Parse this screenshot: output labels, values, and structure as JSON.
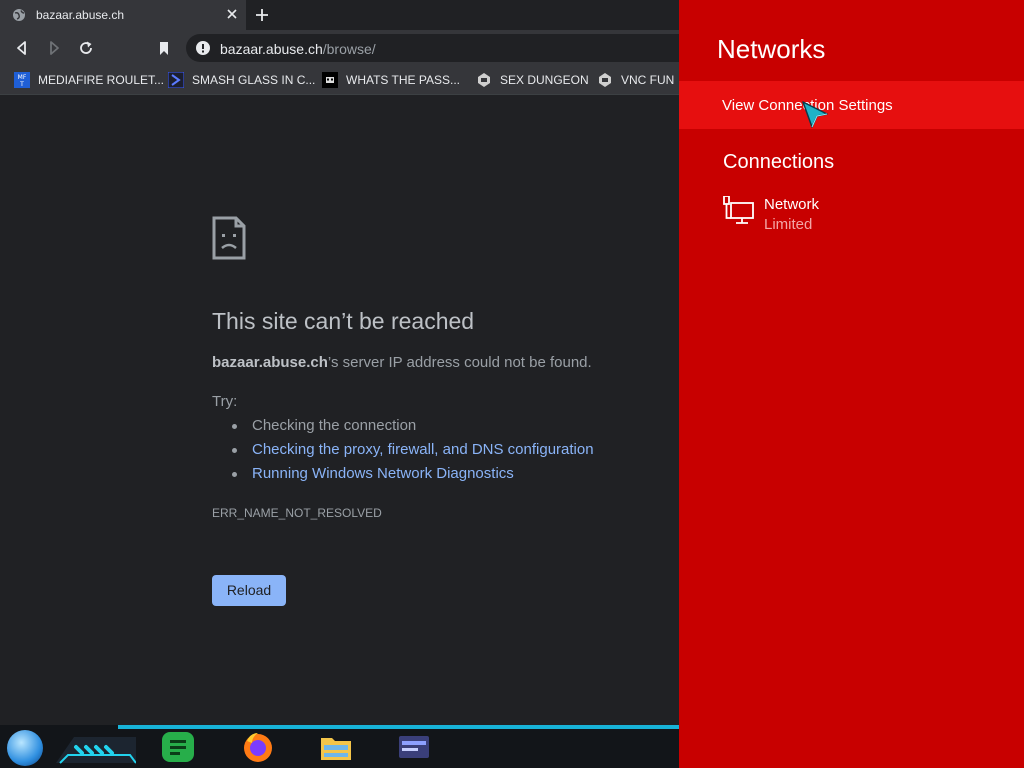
{
  "browser": {
    "tab": {
      "title": "bazaar.abuse.ch",
      "close_glyph": "×"
    },
    "new_tab_glyph": "+",
    "omnibox": {
      "host": "bazaar.abuse.ch",
      "path": "/browse/"
    },
    "bookmarks": [
      {
        "label": "MEDIAFIRE ROULET..."
      },
      {
        "label": "SMASH GLASS IN C..."
      },
      {
        "label": "WHATS THE PASS..."
      },
      {
        "label": "SEX DUNGEON"
      },
      {
        "label": "VNC FUN"
      }
    ]
  },
  "error_page": {
    "title": "This site can’t be reached",
    "host": "bazaar.abuse.ch",
    "message_suffix": "’s server IP address could not be found.",
    "try_label": "Try:",
    "suggestions": [
      {
        "text": "Checking the connection",
        "link": false
      },
      {
        "text": "Checking the proxy, firewall, and DNS configuration",
        "link": true
      },
      {
        "text": "Running Windows Network Diagnostics",
        "link": true
      }
    ],
    "error_code": "ERR_NAME_NOT_RESOLVED",
    "reload_label": "Reload"
  },
  "networks_panel": {
    "title": "Networks",
    "view_settings_label": "View Connection Settings",
    "connections_heading": "Connections",
    "network": {
      "name": "Network",
      "status": "Limited"
    }
  },
  "colors": {
    "panel_bg": "#c80000",
    "panel_highlight": "#e60f0f",
    "link": "#8ab4f8",
    "page_bg": "#202124"
  }
}
